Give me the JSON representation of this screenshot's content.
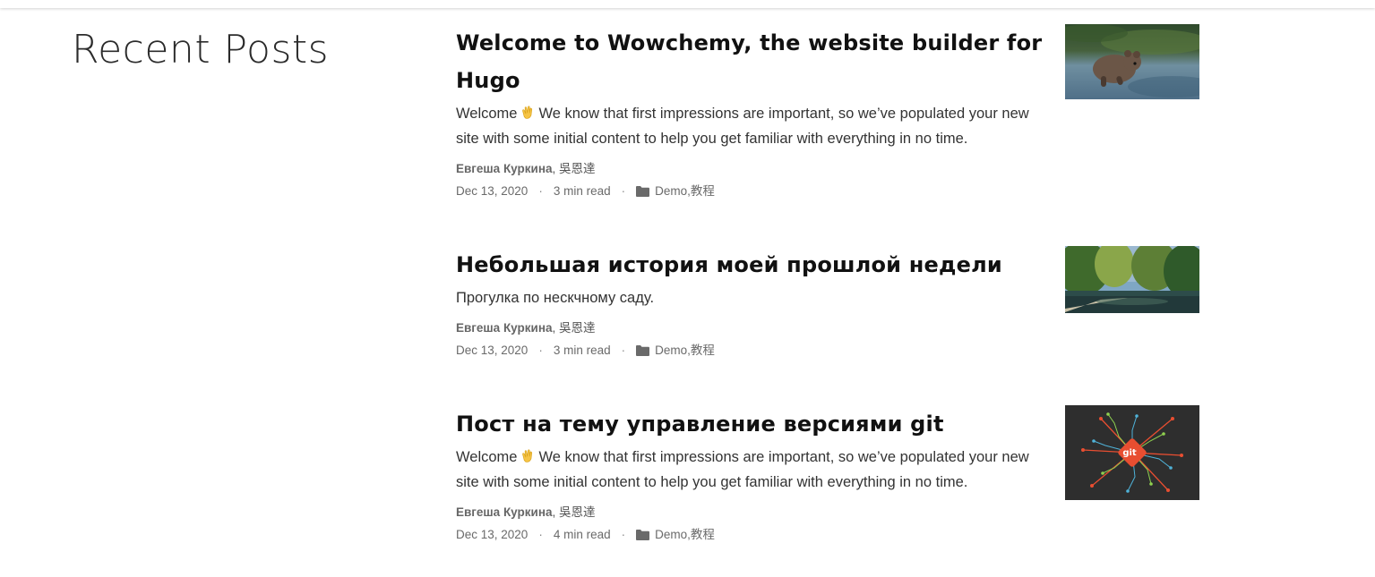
{
  "section": {
    "title": "Recent Posts"
  },
  "posts": [
    {
      "title": "Welcome to Wowchemy, the website builder for Hugo",
      "summary_before": "Welcome",
      "summary_emoji": "clapping-hands-icon",
      "summary_after": "We know that first impressions are important, so we’ve populated your new site with some initial content to help you get familiar with everything in no time.",
      "author1": "Евгеша Куркина",
      "author2": "吳恩達",
      "date": "Dec 13, 2020",
      "read_time": "3 min read",
      "category1": "Demo",
      "category2": "教程",
      "thumbnail": "bear-cub-running-image"
    },
    {
      "title": "Небольшая история моей прошлой недели",
      "summary_before": "Прогулка по нескчному саду.",
      "summary_emoji": "",
      "summary_after": "",
      "author1": "Евгеша Куркина",
      "author2": "吳恩達",
      "date": "Dec 13, 2020",
      "read_time": "3 min read",
      "category1": "Demo",
      "category2": "教程",
      "thumbnail": "garden-pond-image"
    },
    {
      "title": "Пост на тему управление версиями git",
      "summary_before": "Welcome",
      "summary_emoji": "clapping-hands-icon",
      "summary_after": "We know that first impressions are important, so we’ve populated your new site with some initial content to help you get familiar with everything in no time.",
      "author1": "Евгеша Куркина",
      "author2": "吳恩達",
      "date": "Dec 13, 2020",
      "read_time": "4 min read",
      "category1": "Demo",
      "category2": "教程",
      "thumbnail": "git-logo-image",
      "thumbnail_label": "git"
    }
  ],
  "meta": {
    "separator": "·",
    "comma": ", "
  },
  "colors": {
    "title": "#111111",
    "meta": "#6a6a6a",
    "git_accent": "#e84e31"
  }
}
